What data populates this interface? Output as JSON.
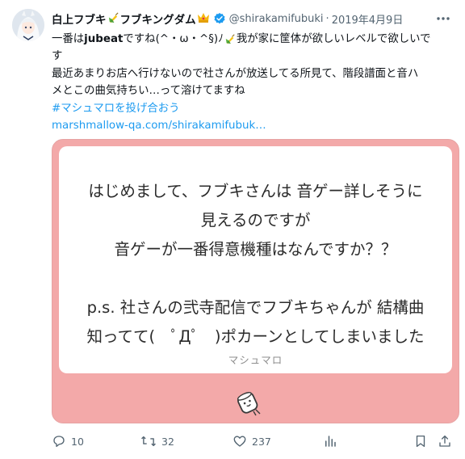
{
  "tweet": {
    "author": {
      "display_name": "白上フブキ",
      "display_name_2": "フブキングダム",
      "handle": "@shirakamifubuki",
      "separator": "·",
      "date": "2019年4月9日"
    },
    "text": {
      "line1_a": "一番は",
      "line1_bold": "jubeat",
      "line1_b": "ですね(^・ω・^§)ﾉ",
      "line1_c": "我が家に筐体が欲しいレベルで欲しいで",
      "line2": "す",
      "line3": "最近あまりお店へ行けないので社さんが放送してる所見て、階段譜面と音ハ",
      "line4": "メとこの曲気持ちい…って溶けてますね",
      "hashtag": "#マシュマロを投げ合おう",
      "url": "marshmallow-qa.com/shirakamifubuk…"
    },
    "card": {
      "q1": "はじめまして、フブキさんは 音ゲー詳しそうに",
      "q2": "見えるのですが",
      "q3": "音ゲーが一番得意機種はなんですか？？",
      "q4": "p.s. 社さんの弐寺配信でフブキちゃんが 結構曲",
      "q5": "知ってて(　ﾟДﾟ　)ポカーンとしてしまいました",
      "brand": "マシュマロ",
      "colors": {
        "border": "#f3a9a9",
        "panel": "#ffffff"
      }
    },
    "actions": {
      "replies": "10",
      "retweets": "32",
      "likes": "237"
    },
    "colors": {
      "link": "#1d9bf0",
      "muted": "#536471",
      "verified": "#1d9bf0"
    }
  }
}
